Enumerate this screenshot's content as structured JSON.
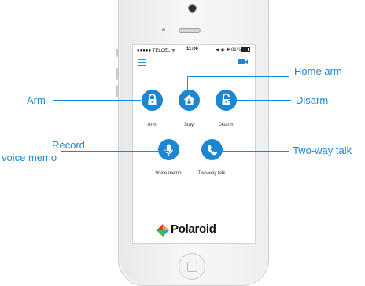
{
  "status_bar": {
    "carrier": "●●●●● TELCEL ᯤ",
    "time": "11:06",
    "right": "◀ ◉ ✱ 81%"
  },
  "icons": {
    "menu": "hamburger-menu-icon",
    "video": "video-camera-icon",
    "arm": "lock-closed-icon",
    "stay": "house-lock-icon",
    "disarm": "lock-open-icon",
    "voice_memo": "microphone-icon",
    "two_way_talk": "phone-handset-icon"
  },
  "buttons": {
    "arm": "Arm",
    "stay": "Stay",
    "disarm": "Disarm",
    "voice_memo": "Voice memo",
    "two_way_talk": "Two-way talk"
  },
  "logo": "Polaroid",
  "callouts": {
    "home_arm": "Home arm",
    "arm": "Arm",
    "disarm": "Disarm",
    "record_line1": "Record",
    "record_line2": "voice memo",
    "two_way_talk": "Two-way talk"
  },
  "colors": {
    "accent": "#1d86d3",
    "callout": "#1e88d8"
  }
}
